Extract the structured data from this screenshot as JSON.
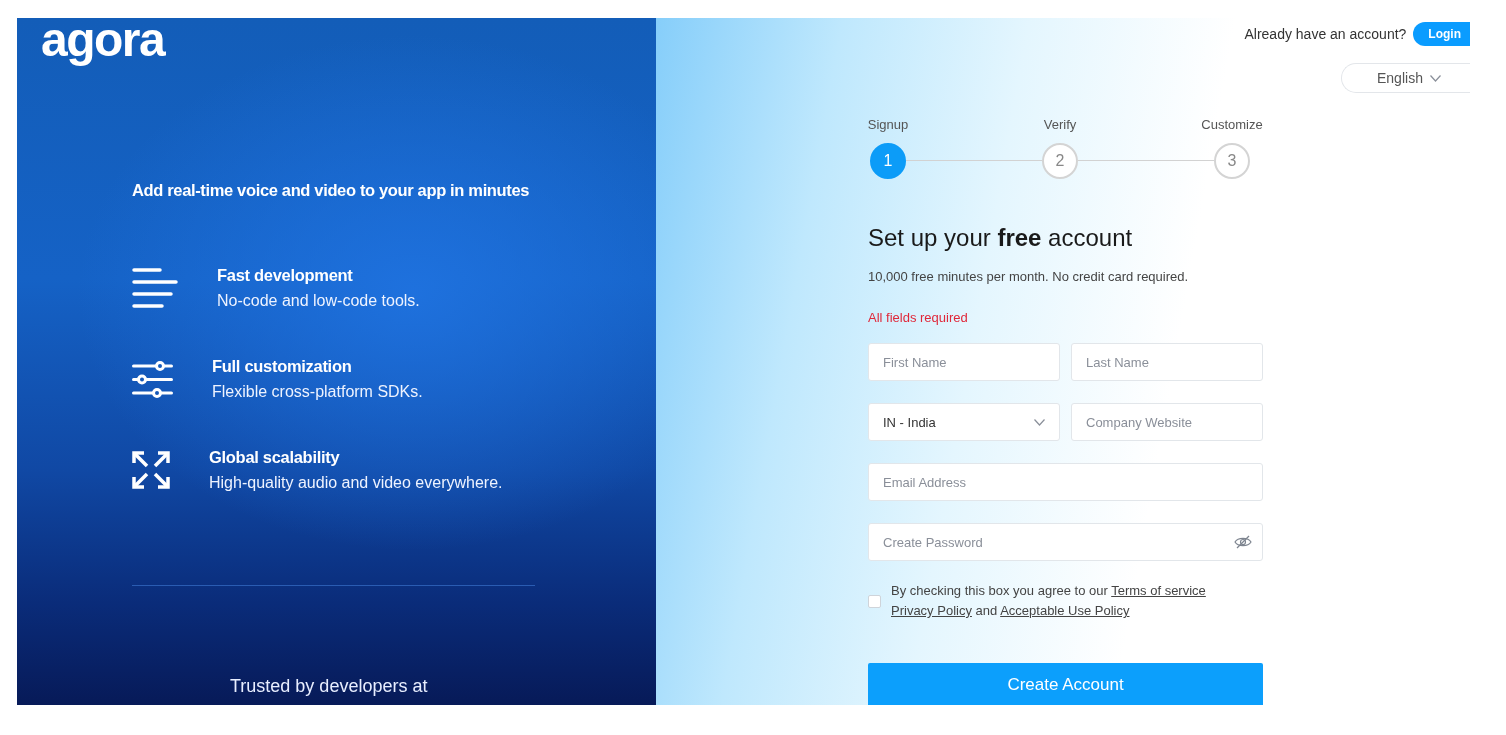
{
  "logo": {
    "text": "agora"
  },
  "hero": {
    "tagline": "Add real-time voice and video to your app in minutes",
    "features": [
      {
        "title": "Fast development",
        "description": "No-code and low-code tools."
      },
      {
        "title": "Full customization",
        "description": "Flexible cross-platform SDKs."
      },
      {
        "title": "Global scalability",
        "description": "High-quality audio and video everywhere."
      }
    ],
    "footer": "Trusted by developers at"
  },
  "header": {
    "prompt": "Already have an account?",
    "login_button": "Login",
    "language_select": {
      "value": "English"
    }
  },
  "steps": [
    {
      "label": "Signup",
      "number": "1",
      "active": true
    },
    {
      "label": "Verify",
      "number": "2",
      "active": false
    },
    {
      "label": "Customize",
      "number": "3",
      "active": false
    }
  ],
  "form": {
    "heading": "Set up your **free** account",
    "subtitle": "10,000 free minutes per month. No credit card required.",
    "required_note": "All fields required",
    "rows": [
      {
        "fields": [
          {
            "kind": "text",
            "placeholder": "First Name"
          },
          {
            "kind": "text",
            "placeholder": "Last Name"
          }
        ]
      },
      {
        "fields": [
          {
            "kind": "select",
            "value": "IN - India"
          },
          {
            "kind": "text",
            "placeholder": "Company Website"
          }
        ]
      },
      {
        "fields": [
          {
            "kind": "text",
            "placeholder": "Email Address"
          }
        ]
      },
      {
        "fields": [
          {
            "kind": "password",
            "placeholder": "Create Password"
          }
        ]
      }
    ],
    "consent": {
      "checked": false,
      "parts": [
        {
          "kind": "text",
          "text": "By checking this box you agree to our"
        },
        {
          "kind": "link",
          "text": "Terms of service"
        },
        {
          "kind": "link",
          "text": "Privacy Policy"
        },
        {
          "kind": "text",
          "text": "and"
        },
        {
          "kind": "link",
          "text": "Acceptable Use Policy"
        }
      ]
    },
    "submit_button": "Create Account"
  }
}
